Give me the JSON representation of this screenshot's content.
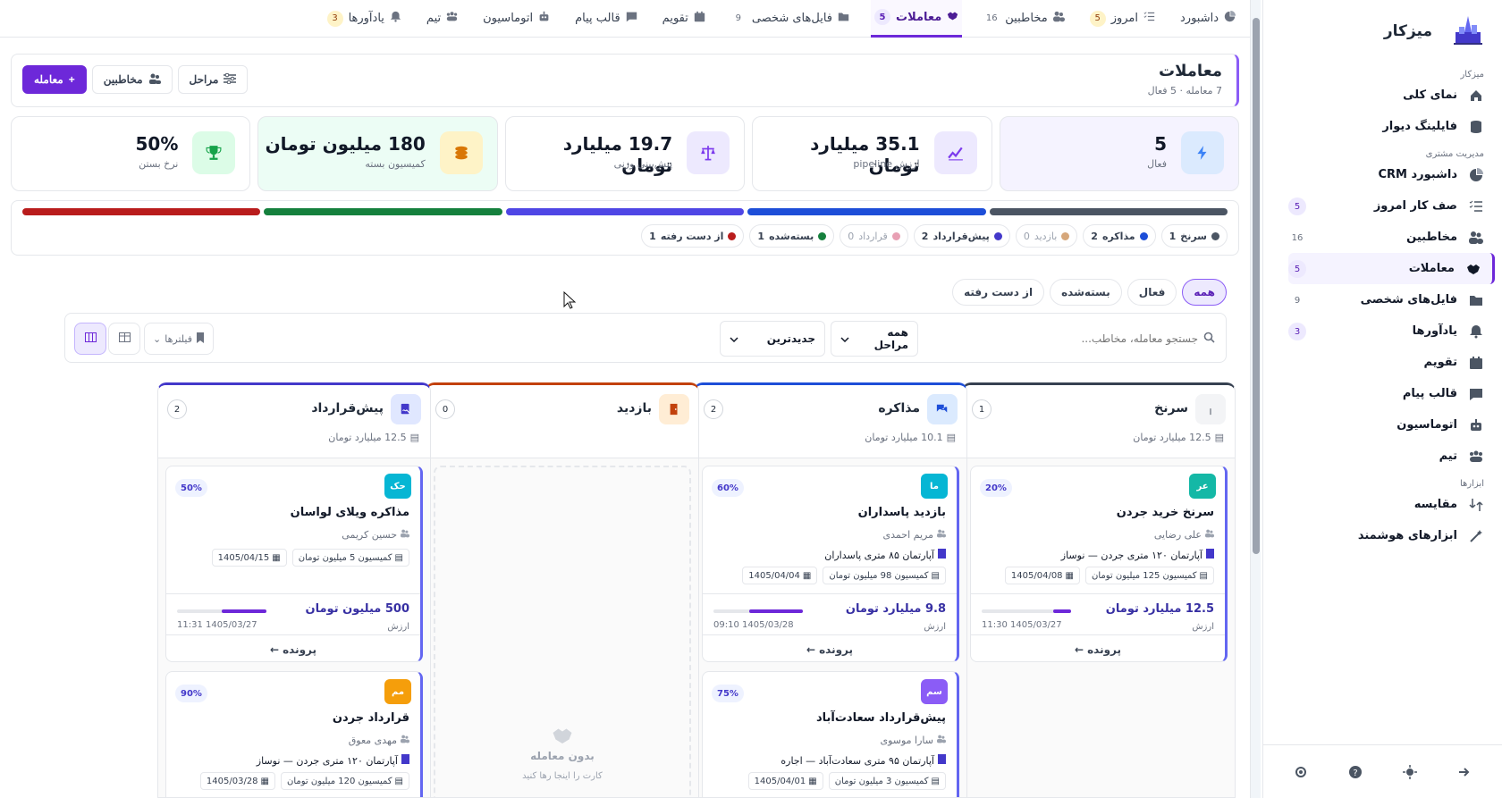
{
  "sidebar": {
    "title": "میزکار",
    "sections": [
      {
        "label": "میزکار",
        "items": [
          {
            "label": "نمای کلی",
            "icon": "home-icon"
          },
          {
            "label": "فایلینگ دیوار",
            "icon": "database-icon"
          }
        ]
      },
      {
        "label": "مدیریت مشتری",
        "items": [
          {
            "label": "داشبورد CRM",
            "icon": "pie-chart-icon"
          },
          {
            "label": "صف کار امروز",
            "icon": "checklist-icon",
            "badge": "5"
          },
          {
            "label": "مخاطبین",
            "icon": "users-icon",
            "badge": "16"
          },
          {
            "label": "معاملات",
            "icon": "handshake-icon",
            "badge": "5",
            "active": true
          },
          {
            "label": "فایل‌های شخصی",
            "icon": "folder-icon",
            "badge": "9"
          },
          {
            "label": "یادآورها",
            "icon": "bell-icon",
            "badge": "3"
          },
          {
            "label": "تقویم",
            "icon": "calendar-icon"
          },
          {
            "label": "قالب پیام",
            "icon": "message-icon"
          },
          {
            "label": "اتوماسیون",
            "icon": "robot-icon"
          },
          {
            "label": "تیم",
            "icon": "team-icon"
          }
        ]
      },
      {
        "label": "ابزارها",
        "items": [
          {
            "label": "مقایسه",
            "icon": "compare-icon"
          },
          {
            "label": "ابزارهای هوشمند",
            "icon": "magic-wand-icon"
          }
        ]
      }
    ]
  },
  "topnav": [
    {
      "label": "داشبورد",
      "icon": "pie-chart-icon"
    },
    {
      "label": "امروز",
      "icon": "checklist-icon",
      "badge": "5",
      "bt": "y"
    },
    {
      "label": "مخاطبین",
      "icon": "users-icon",
      "badge": "16",
      "bt": "g"
    },
    {
      "label": "معاملات",
      "icon": "handshake-icon",
      "badge": "5",
      "bt": "p",
      "active": true
    },
    {
      "label": "فایل‌های شخصی",
      "icon": "folder-icon",
      "badge": "9",
      "bt": "g"
    },
    {
      "label": "تقویم",
      "icon": "calendar-icon"
    },
    {
      "label": "قالب پیام",
      "icon": "message-icon"
    },
    {
      "label": "اتوماسیون",
      "icon": "robot-icon"
    },
    {
      "label": "تیم",
      "icon": "team-icon"
    },
    {
      "label": "یادآورها",
      "icon": "bell-icon",
      "badge": "3",
      "bt": "y"
    }
  ],
  "header": {
    "title": "معاملات",
    "subtitle": "7 معامله · 5 فعال",
    "new_deal": "معامله",
    "contacts": "مخاطبین",
    "stages": "مراحل"
  },
  "stats": [
    {
      "value": "5",
      "label": "فعال",
      "icon": "bolt-icon",
      "color": "#3b82f6",
      "bg": "#dbeafe",
      "card": "#f5f3ff"
    },
    {
      "value": "35.1 میلیارد تومان",
      "label": "ارزش pipeline",
      "icon": "line-chart-icon",
      "color": "#7c3aed",
      "bg": "#ede9fe",
      "card": "#ffffff"
    },
    {
      "value": "19.7 میلیارد تومان",
      "label": "پیش‌بینی وزنی",
      "icon": "scale-icon",
      "color": "#7c3aed",
      "bg": "#ede9fe",
      "card": "#ffffff"
    },
    {
      "value": "180 میلیون تومان",
      "label": "کمیسیون بسته",
      "icon": "coins-icon",
      "color": "#d97706",
      "bg": "#fef3c7",
      "card": "#ecfdf5"
    },
    {
      "value": "50%",
      "label": "نرخ بستن",
      "icon": "trophy-icon",
      "color": "#16a34a",
      "bg": "#dcfce7",
      "card": "#ffffff"
    }
  ],
  "pipeline_bar_colors": [
    "#b91c1c",
    "#15803d",
    "#4f46e5",
    "#1d4ed8",
    "#4b5563"
  ],
  "stage_chips": [
    {
      "label": "سرنخ",
      "count": "1",
      "color": "#4b5563"
    },
    {
      "label": "مذاکره",
      "count": "2",
      "color": "#1d4ed8"
    },
    {
      "label": "بازدید",
      "count": "0",
      "color": "#d6a77a",
      "dim": true
    },
    {
      "label": "پیش‌قرارداد",
      "count": "2",
      "color": "#4338ca"
    },
    {
      "label": "قرارداد",
      "count": "0",
      "color": "#e8a0b4",
      "dim": true
    },
    {
      "label": "بسته‌شده",
      "count": "1",
      "color": "#15803d"
    },
    {
      "label": "از دست رفته",
      "count": "1",
      "color": "#b91c1c"
    }
  ],
  "filters": [
    "همه",
    "فعال",
    "بسته‌شده",
    "از دست رفته"
  ],
  "toolbar": {
    "search_placeholder": "جستجو معامله، مخاطب...",
    "stage_select": "همه مراحل",
    "sort_select": "جدیدترین",
    "filters_label": "فیلترها"
  },
  "columns": [
    {
      "title": "سرنخ",
      "count": "1",
      "sum": "12.5 میلیارد تومان",
      "color": "#374151",
      "icon": "sprout-icon",
      "icbg": "#f3f4f6",
      "cards": [
        {
          "avatar": "عر",
          "avcolor": "#14b8a6",
          "pct": "20%",
          "title": "سرنخ خرید جردن",
          "person": "علی رضایی",
          "prop": "آپارتمان ۱۲۰ متری جردن — نوساز",
          "commission": "کمیسیون 125 میلیون تومان",
          "date": "1405/04/08",
          "amount": "12.5 میلیارد تومان",
          "amount_label": "ارزش",
          "time": "1405/03/27 11:30",
          "progress": 20,
          "footer": "پرونده"
        }
      ]
    },
    {
      "title": "مذاکره",
      "count": "2",
      "sum": "10.1 میلیارد تومان",
      "color": "#1d4ed8",
      "icon": "chat-icon",
      "icbg": "#dbeafe",
      "cards": [
        {
          "avatar": "ما",
          "avcolor": "#06b6d4",
          "pct": "60%",
          "title": "بازدید پاسداران",
          "person": "مریم احمدی",
          "prop": "آپارتمان ۸۵ متری پاسداران",
          "commission": "کمیسیون 98 میلیون تومان",
          "date": "1405/04/04",
          "amount": "9.8 میلیارد تومان",
          "amount_label": "ارزش",
          "time": "1405/03/28 09:10",
          "progress": 60,
          "footer": "پرونده"
        },
        {
          "avatar": "سم",
          "avcolor": "#8b5cf6",
          "pct": "75%",
          "title": "پیش‌قرارداد سعادت‌آباد",
          "person": "سارا موسوی",
          "prop": "آپارتمان ۹۵ متری سعادت‌آباد — اجاره",
          "commission": "کمیسیون 3 میلیون تومان",
          "date": "1405/04/01"
        }
      ]
    },
    {
      "title": "بازدید",
      "count": "0",
      "sum": "",
      "color": "#c2410c",
      "icon": "door-icon",
      "icbg": "#ffedd5",
      "empty_title": "بدون معامله",
      "empty_sub": "کارت را اینجا رها کنید",
      "cards": []
    },
    {
      "title": "پیش‌قرارداد",
      "count": "2",
      "sum": "12.5 میلیارد تومان",
      "color": "#4338ca",
      "icon": "signature-icon",
      "icbg": "#e0e7ff",
      "cards": [
        {
          "avatar": "حک",
          "avcolor": "#06b6d4",
          "pct": "50%",
          "title": "مذاکره ویلای لواسان",
          "person": "حسین کریمی",
          "prop": "",
          "commission": "کمیسیون 5 میلیون تومان",
          "date": "1405/04/15",
          "amount": "500 میلیون تومان",
          "amount_label": "ارزش",
          "time": "1405/03/27 11:31",
          "progress": 50,
          "footer": "پرونده"
        },
        {
          "avatar": "مم",
          "avcolor": "#f59e0b",
          "pct": "90%",
          "title": "قرارداد جردن",
          "person": "مهدی معوق",
          "prop": "آپارتمان ۱۲۰ متری جردن — نوساز",
          "commission": "کمیسیون 120 میلیون تومان",
          "date": "1405/03/28"
        }
      ]
    }
  ]
}
